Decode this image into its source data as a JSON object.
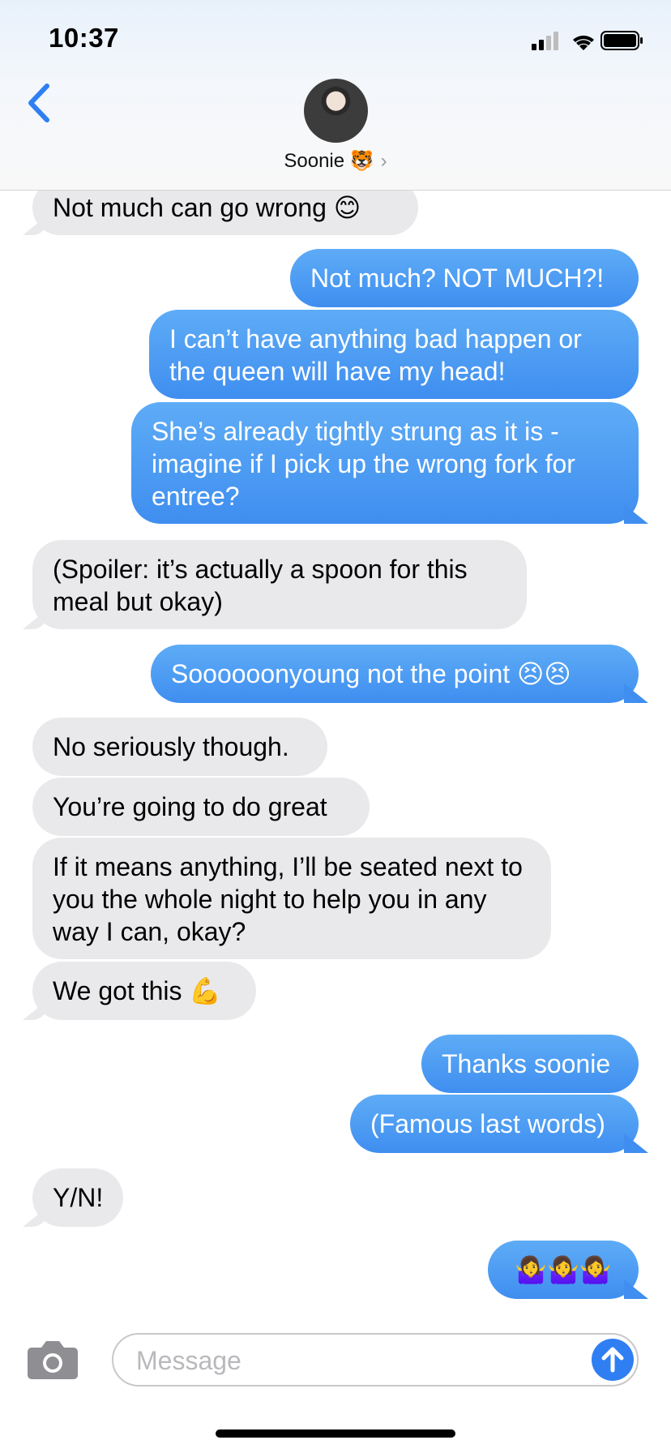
{
  "status_bar": {
    "time": "10:37"
  },
  "header": {
    "contact_name": "Soonie 🐯",
    "chevron": "›"
  },
  "messages": [
    {
      "from": "them",
      "text": "Not much can go wrong 😊"
    },
    {
      "from": "me",
      "text": "Not much? NOT MUCH?!"
    },
    {
      "from": "me",
      "text": "I can’t have anything bad happen or the queen will have my head!"
    },
    {
      "from": "me",
      "text": "She’s already tightly strung as it is - imagine if I pick up the wrong fork for entree?"
    },
    {
      "from": "them",
      "text": "(Spoiler: it’s actually a spoon for this meal but okay)"
    },
    {
      "from": "me",
      "text": "Soooooonyoung not the point 😣😣"
    },
    {
      "from": "them",
      "text": "No seriously though."
    },
    {
      "from": "them",
      "text": "You’re going to do great"
    },
    {
      "from": "them",
      "text": "If it means anything, I’ll be seated next to you the whole night to help you in any way I can, okay?"
    },
    {
      "from": "them",
      "text": "We got this 💪"
    },
    {
      "from": "me",
      "text": "Thanks soonie"
    },
    {
      "from": "me",
      "text": "(Famous last words)"
    },
    {
      "from": "them",
      "text": "Y/N!"
    },
    {
      "from": "me",
      "text": "🤷‍♀️🤷‍♀️🤷‍♀️"
    }
  ],
  "composer": {
    "placeholder": "Message"
  },
  "colors": {
    "outgoing": "#3f8ef0",
    "incoming": "#e9e9eb",
    "accent": "#2f7ff3"
  }
}
